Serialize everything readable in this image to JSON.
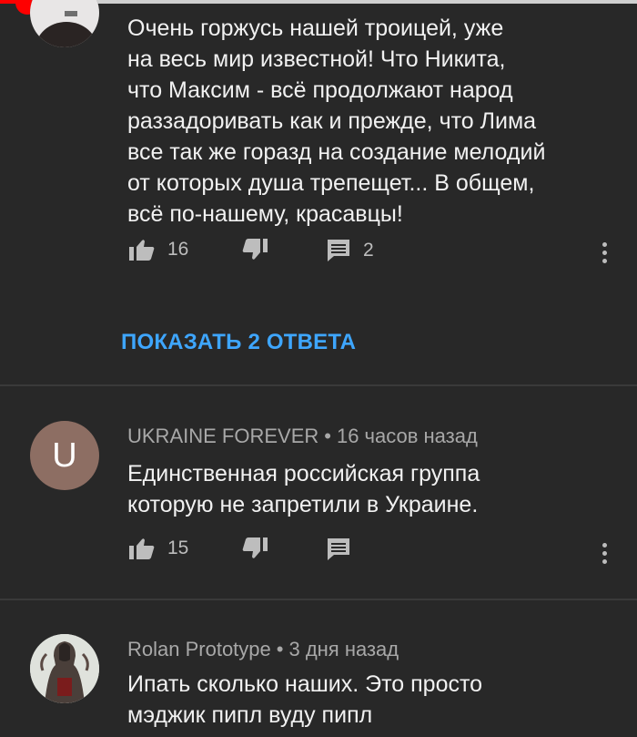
{
  "player": {
    "progress": 0.04
  },
  "comments": [
    {
      "author": "",
      "time": "",
      "text": "Очень горжусь нашей троицей, уже\nна весь мир известной! Что Никита,\nчто Максим - всё продолжают народ\nраззадоривать как и прежде, что Лима\nвсе так же горазд на создание мелодий\nот которых душа трепещет... В общем,\nвсё по-нашему, красавцы!",
      "likes": "16",
      "replies_count": "2",
      "show_replies": "ПОКАЗАТЬ 2 ОТВЕТА"
    },
    {
      "author": "UKRAINE FOREVER",
      "time": "16 часов назад",
      "avatar_letter": "U",
      "avatar_color": "#8d6e63",
      "text": "Единственная российская группа\nкоторую не запретили в Украине.",
      "likes": "15",
      "replies_count": ""
    },
    {
      "author": "Rolan Prototype",
      "time": "3 дня назад",
      "text": "Ипать сколько наших. Это просто\nмэджик пипл вуду пипл"
    }
  ],
  "colors": {
    "accent_blue": "#3ea6ff",
    "background": "#282828",
    "text": "#f1f1f1",
    "muted": "#a8a8a8"
  },
  "icons": [
    "thumbs-up-icon",
    "thumbs-down-icon",
    "reply-icon",
    "more-vert-icon"
  ]
}
